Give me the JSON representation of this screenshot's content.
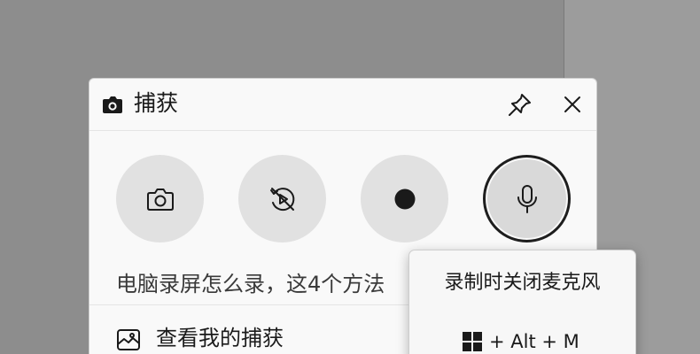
{
  "panel": {
    "title": "捕获",
    "title_icon": "camera-icon",
    "pin_icon": "pin-icon",
    "close_icon": "close-icon"
  },
  "capture_buttons": [
    {
      "name": "screenshot",
      "icon": "camera-icon"
    },
    {
      "name": "record-last-30s",
      "icon": "rewind-record-off-icon"
    },
    {
      "name": "start-recording",
      "icon": "record-dot-icon"
    },
    {
      "name": "microphone",
      "icon": "microphone-icon"
    }
  ],
  "widget": {
    "caption": "电脑录屏怎么录，这4个方法",
    "gallery_link": "查看我的捕获",
    "gallery_icon": "gallery-icon"
  },
  "tooltip": {
    "title": "录制时关闭麦克风",
    "shortcut": "+ Alt + M",
    "key_icon": "windows-key-icon"
  },
  "colors": {
    "background": "#8d8d8d",
    "panel": "#f9f9f9",
    "button": "#e1e1e1",
    "text": "#1a1a1a"
  }
}
